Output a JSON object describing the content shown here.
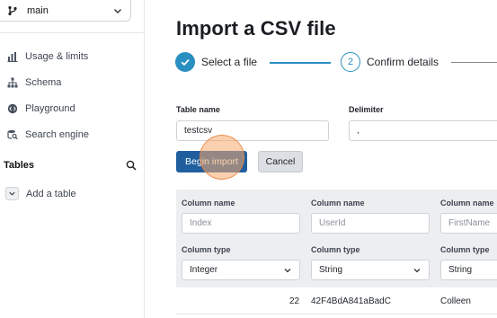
{
  "sidebar": {
    "branch": "main",
    "nav": [
      {
        "label": "Usage & limits",
        "icon": "bar-chart-icon"
      },
      {
        "label": "Schema",
        "icon": "schema-icon"
      },
      {
        "label": "Playground",
        "icon": "playground-icon"
      },
      {
        "label": "Search engine",
        "icon": "search-engine-icon"
      }
    ],
    "tables_heading": "Tables",
    "add_table": "Add a table"
  },
  "main": {
    "title": "Import a CSV file",
    "steps": [
      {
        "number": "1",
        "label": "Select a file",
        "status": "done"
      },
      {
        "number": "2",
        "label": "Confirm details",
        "status": "active"
      }
    ],
    "table_name_label": "Table name",
    "table_name_value": "testcsv",
    "delimiter_label": "Delimiter",
    "delimiter_value": ",",
    "begin_import": "Begin import",
    "cancel": "Cancel"
  },
  "columns": [
    {
      "name_label": "Column name",
      "name_placeholder": "Index",
      "type_label": "Column type",
      "type_value": "Integer"
    },
    {
      "name_label": "Column name",
      "name_placeholder": "UserId",
      "type_label": "Column type",
      "type_value": "String"
    },
    {
      "name_label": "Column name",
      "name_placeholder": "FirstName",
      "type_label": "Column type",
      "type_value": "String"
    }
  ],
  "preview_row": [
    "22",
    "42F4BdA841aBadC",
    "Colleen"
  ],
  "colors": {
    "accent": "#2a8fc1",
    "primary_button": "#1f5fa0",
    "click_indicator": "#f6aa6e"
  }
}
